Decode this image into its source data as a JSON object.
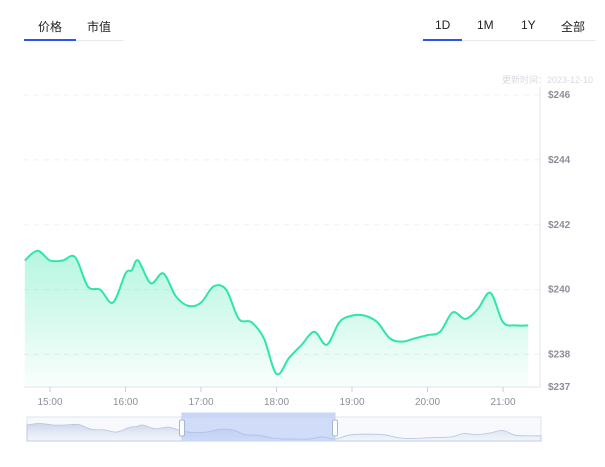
{
  "tabs": {
    "metric": [
      {
        "label": "价格",
        "active": true
      },
      {
        "label": "市值",
        "active": false
      }
    ],
    "range": [
      {
        "label": "1D",
        "active": true
      },
      {
        "label": "1M",
        "active": false
      },
      {
        "label": "1Y",
        "active": false
      },
      {
        "label": "全部",
        "active": false
      }
    ]
  },
  "updated_label": "更新时间：2023-12-10",
  "colors": {
    "line": "#2ee6a6",
    "accent": "#2f54eb",
    "grid": "#edf0f4",
    "axis_text": "#8a8f99"
  },
  "chart_data": {
    "type": "area",
    "title": "",
    "xlabel": "",
    "ylabel": "",
    "grid": true,
    "ylim": [
      237,
      246
    ],
    "y_ticks": [
      237,
      238,
      240,
      242,
      244,
      246
    ],
    "y_tick_labels": [
      "$237",
      "$238",
      "$240",
      "$242",
      "$244",
      "$246"
    ],
    "x_ticks": [
      "15:00",
      "16:00",
      "17:00",
      "18:00",
      "19:00",
      "20:00",
      "21:00"
    ],
    "x": [
      "14:40",
      "14:50",
      "15:00",
      "15:10",
      "15:20",
      "15:30",
      "15:40",
      "15:50",
      "16:00",
      "16:05",
      "16:10",
      "16:20",
      "16:30",
      "16:40",
      "16:50",
      "17:00",
      "17:10",
      "17:20",
      "17:30",
      "17:40",
      "17:50",
      "18:00",
      "18:10",
      "18:20",
      "18:30",
      "18:40",
      "18:50",
      "19:00",
      "19:10",
      "19:20",
      "19:30",
      "19:40",
      "19:50",
      "20:00",
      "20:10",
      "20:20",
      "20:30",
      "20:40",
      "20:50",
      "21:00",
      "21:10",
      "21:20"
    ],
    "series": [
      {
        "values": [
          240.9,
          241.2,
          240.9,
          240.9,
          241.0,
          240.1,
          240.0,
          239.6,
          240.5,
          240.6,
          240.9,
          240.2,
          240.5,
          239.8,
          239.5,
          239.6,
          240.1,
          240.0,
          239.1,
          239.0,
          238.5,
          237.4,
          237.9,
          238.3,
          238.7,
          238.3,
          239.0,
          239.2,
          239.2,
          239.0,
          238.5,
          238.4,
          238.5,
          238.6,
          238.7,
          239.3,
          239.1,
          239.4,
          239.9,
          239.0,
          238.9,
          238.9
        ]
      }
    ]
  }
}
